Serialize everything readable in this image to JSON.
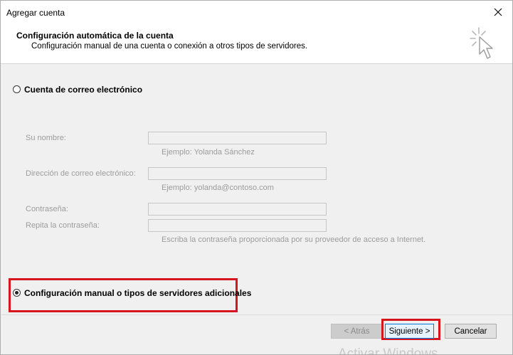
{
  "window": {
    "title": "Agregar cuenta"
  },
  "header": {
    "title": "Configuración automática de la cuenta",
    "subtitle": "Configuración manual de una cuenta o conexión a otros tipos de servidores."
  },
  "options": {
    "email_account_label": "Cuenta de correo electrónico",
    "manual_config_label": "Configuración manual o tipos de servidores adicionales",
    "selected": "manual_config"
  },
  "form": {
    "name_label": "Su nombre:",
    "name_value": "",
    "name_hint": "Ejemplo: Yolanda Sánchez",
    "email_label": "Dirección de correo electrónico:",
    "email_value": "",
    "email_hint": "Ejemplo: yolanda@contoso.com",
    "password_label": "Contraseña:",
    "password_value": "",
    "repeat_password_label": "Repita la contraseña:",
    "repeat_password_value": "",
    "password_hint": "Escriba la contraseña proporcionada por su proveedor de acceso a Internet."
  },
  "buttons": {
    "back_label": "< Atrás",
    "next_label": "Siguiente >",
    "cancel_label": "Cancelar"
  },
  "watermark": {
    "text": "Activar Windows"
  },
  "colors": {
    "highlight": "#d7151f",
    "focus_border": "#0078d7",
    "disabled_text": "#9c9c9c",
    "panel_background": "#f0f0f0"
  },
  "icons": {
    "close": "close-icon",
    "wizard": "magic-cursor-icon"
  }
}
